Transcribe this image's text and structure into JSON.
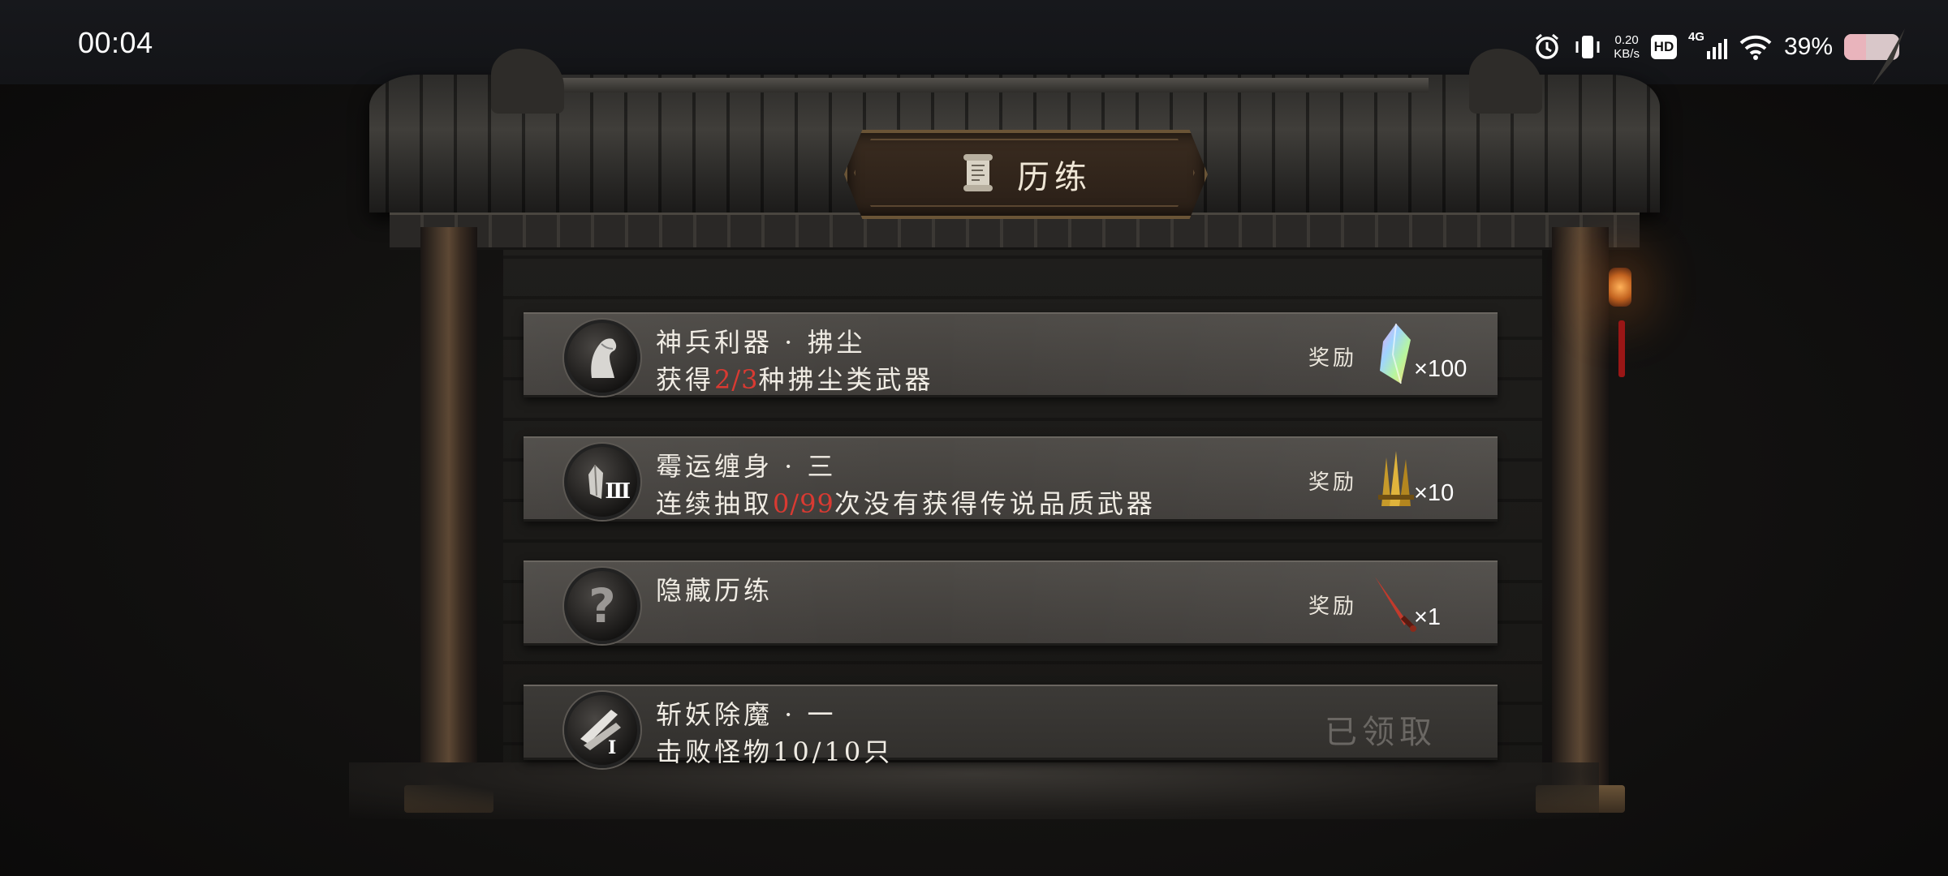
{
  "status_bar": {
    "time": "00:04",
    "net_speed_value": "0.20",
    "net_speed_unit": "KB/s",
    "hd": "HD",
    "network": "4G",
    "battery_percent": "39%",
    "battery_level": 0.39
  },
  "panel": {
    "title": "历练",
    "title_icon": "scroll-icon"
  },
  "tasks": [
    {
      "title": "神兵利器 · 拂尘",
      "desc_before": "获得",
      "desc_progress": "2/3",
      "desc_after": "种拂尘类武器",
      "icon": "horse-head-icon",
      "reward_label": "奖励",
      "reward_item": "rainbow-crystal-icon",
      "reward_count": "×100"
    },
    {
      "title": "霉运缠身 · 三",
      "desc_before": "连续抽取",
      "desc_progress": "0/99",
      "desc_after": "次没有获得传说品质武器",
      "icon": "crystal-rank-three-icon",
      "icon_badge": "Ⅲ",
      "reward_label": "奖励",
      "reward_item": "golden-blades-icon",
      "reward_count": "×10"
    },
    {
      "title": "隐藏历练",
      "icon": "question-mark-icon",
      "icon_glyph": "?",
      "reward_label": "奖励",
      "reward_item": "red-sword-icon",
      "reward_count": "×1"
    },
    {
      "title": "斩妖除魔 · 一",
      "desc": "击败怪物10/10只",
      "icon": "slash-rank-one-icon",
      "claimed_label": "已领取"
    }
  ],
  "colors": {
    "progress_highlight": "#d93a32",
    "card_bg": "#47443f",
    "claimed_text": "#6a6763"
  }
}
